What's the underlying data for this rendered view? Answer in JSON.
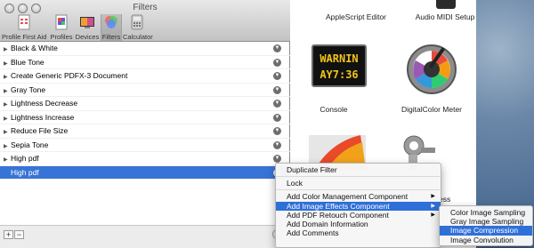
{
  "window": {
    "title": "Filters"
  },
  "toolbar": [
    {
      "label": "Profile First Aid",
      "icon": "profile-first-aid-icon"
    },
    {
      "label": "Profiles",
      "icon": "profiles-icon"
    },
    {
      "label": "Devices",
      "icon": "devices-icon"
    },
    {
      "label": "Filters",
      "icon": "filters-icon",
      "selected": true
    },
    {
      "label": "Calculator",
      "icon": "calculator-icon"
    }
  ],
  "filters": [
    "Black & White",
    "Blue Tone",
    "Create Generic PDFX-3 Document",
    "Gray Tone",
    "Lightness Decrease",
    "Lightness Increase",
    "Reduce File Size",
    "Sepia Tone",
    "High pdf",
    "High pdf"
  ],
  "bottom": {
    "add": "+",
    "remove": "−"
  },
  "apps": {
    "applescript": "AppleScript Editor",
    "midi": "Audio MIDI Setup",
    "console": "Console",
    "console_icon_text_1": "WARNIN",
    "console_icon_text_2": "AY7:36",
    "dcm": "DigitalColor Meter",
    "partial": "ess"
  },
  "context_menu": {
    "items": [
      "Duplicate Filter",
      "Lock",
      "Add Color Management Component",
      "Add Image Effects Component",
      "Add PDF Retouch Component",
      "Add Domain Information",
      "Add Comments"
    ]
  },
  "submenu": {
    "items": [
      "Color Image Sampling",
      "Gray Image Sampling",
      "Image Compression",
      "Image Convolution"
    ]
  },
  "colors": {
    "selection": "#3874d7",
    "menu_highlight": "#2f6fd8"
  }
}
